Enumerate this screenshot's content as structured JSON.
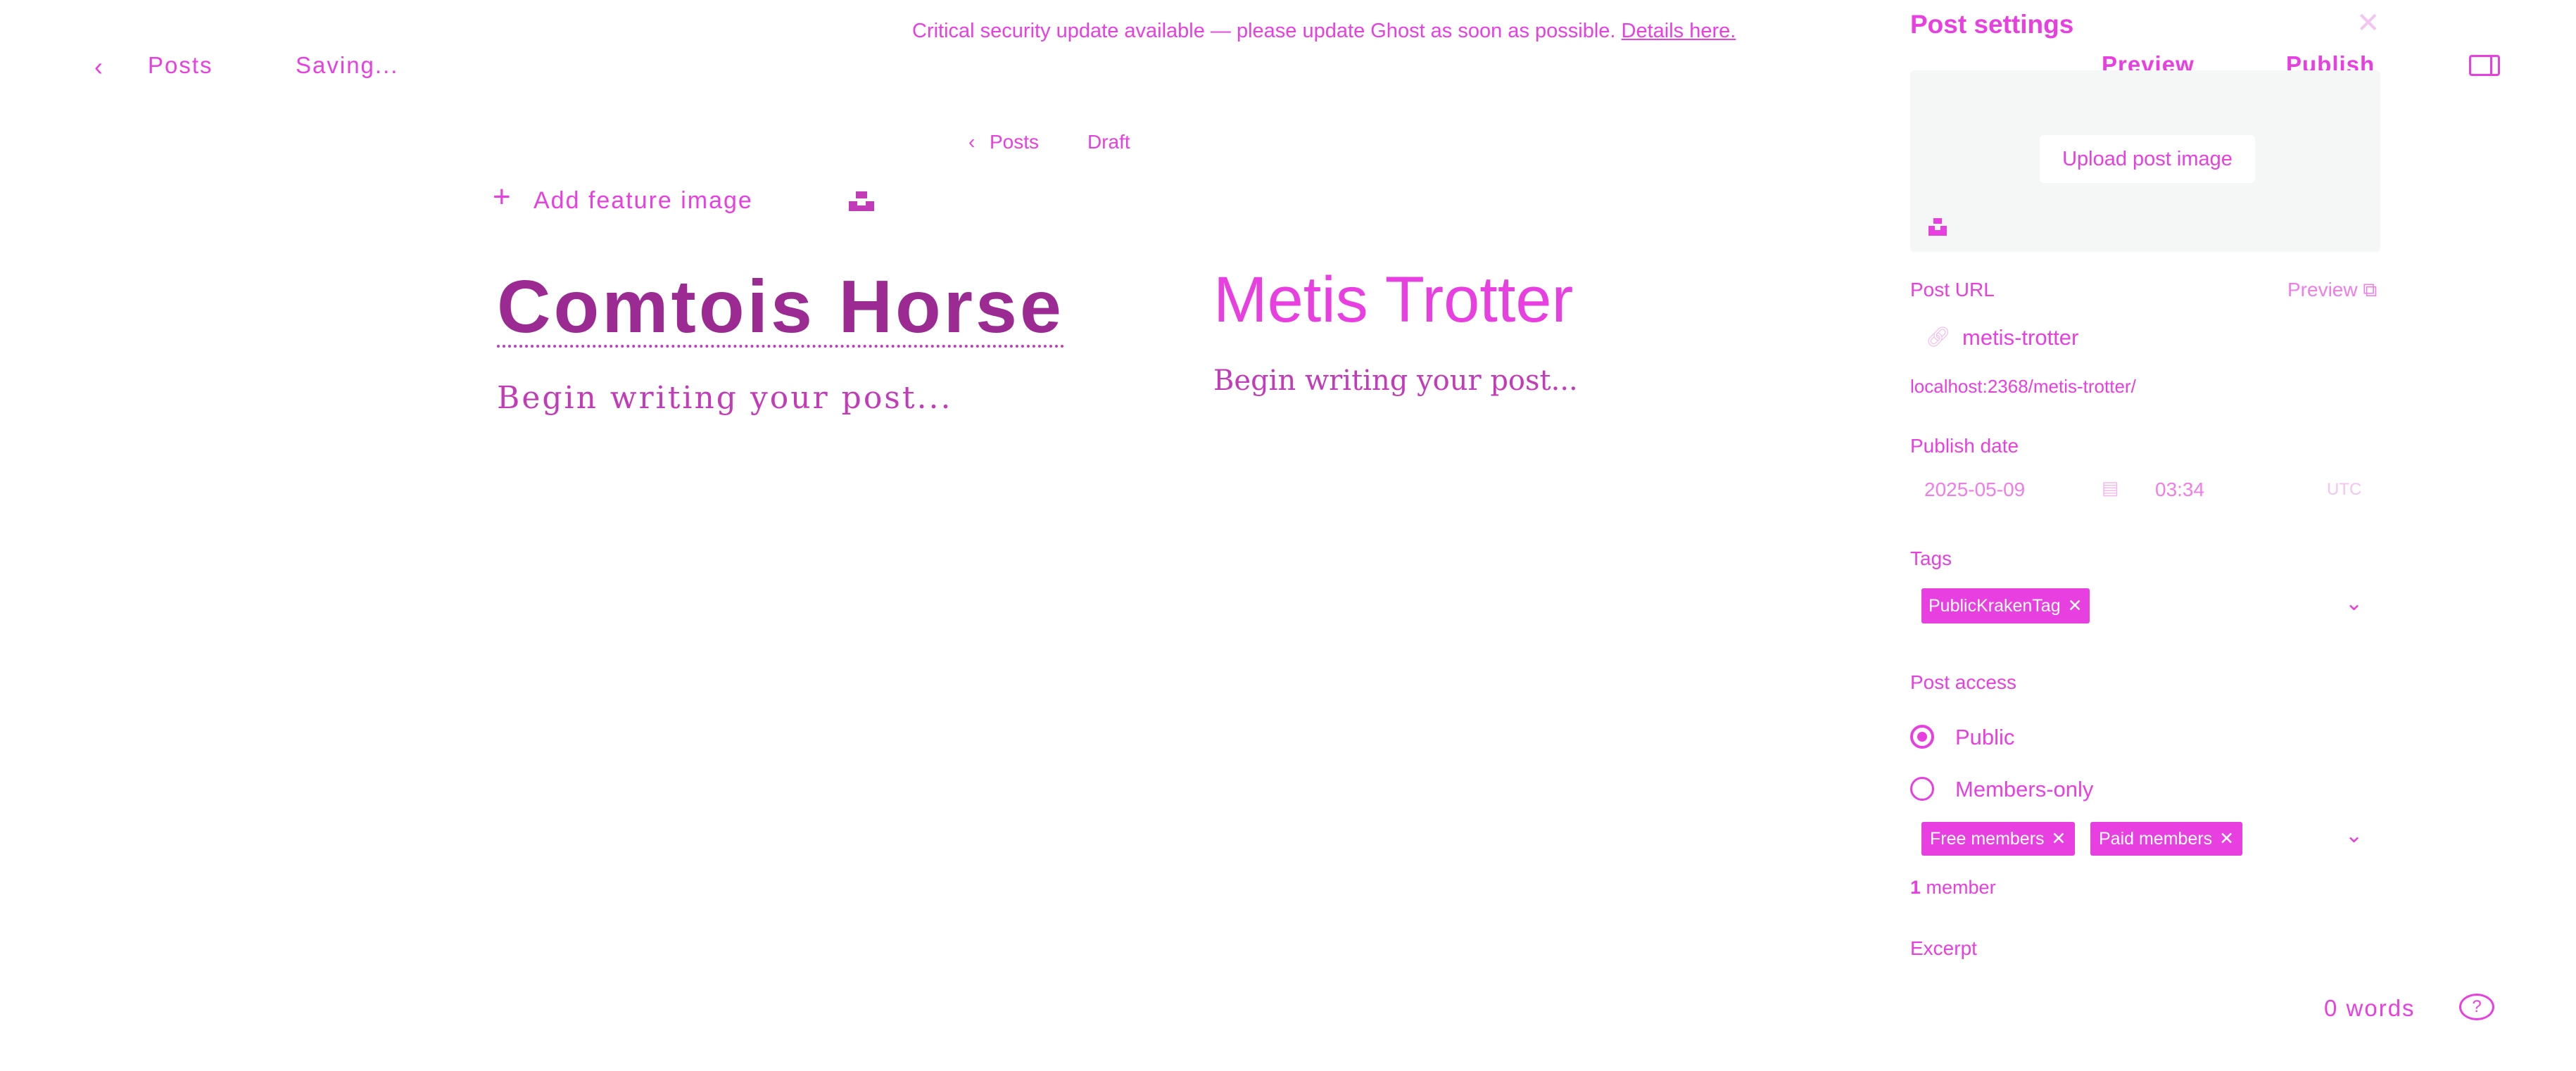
{
  "notice": {
    "text": "Critical security update available — please update Ghost as soon as possible.",
    "link_label": "Details here."
  },
  "topbar": {
    "back_label": "Posts",
    "status": "Saving...",
    "preview_label": "Preview",
    "publish_label": "Publish"
  },
  "editor": {
    "breadcrumb": {
      "posts_label": "Posts",
      "status": "Draft"
    },
    "add_feature_label": "Add feature image",
    "title_previous": "Comtois Horse",
    "title_current": "Metis Trotter",
    "body_placeholder_previous": "Begin writing your post...",
    "body_placeholder_current": "Begin writing your post..."
  },
  "settings": {
    "title": "Post settings",
    "upload_label": "Upload post image",
    "url": {
      "label": "Post URL",
      "preview_label": "Preview",
      "slug": "metis-trotter",
      "full_url": "localhost:2368/metis-trotter/"
    },
    "publish_date": {
      "label": "Publish date",
      "date": "2025-05-09",
      "time": "03:34",
      "timezone": "UTC"
    },
    "tags": {
      "label": "Tags",
      "items": [
        "PublicKrakenTag"
      ]
    },
    "access": {
      "label": "Post access",
      "options": [
        "Public",
        "Members-only"
      ],
      "selected": "Public",
      "segments": [
        "Free members",
        "Paid members"
      ],
      "member_count": "1",
      "member_word": "member"
    },
    "excerpt_label": "Excerpt"
  },
  "footer": {
    "word_count": "0 words"
  },
  "colors": {
    "accent": "#e83fe0",
    "title_dark": "#9b2a93",
    "panel_bg": "#f5f6f6"
  }
}
